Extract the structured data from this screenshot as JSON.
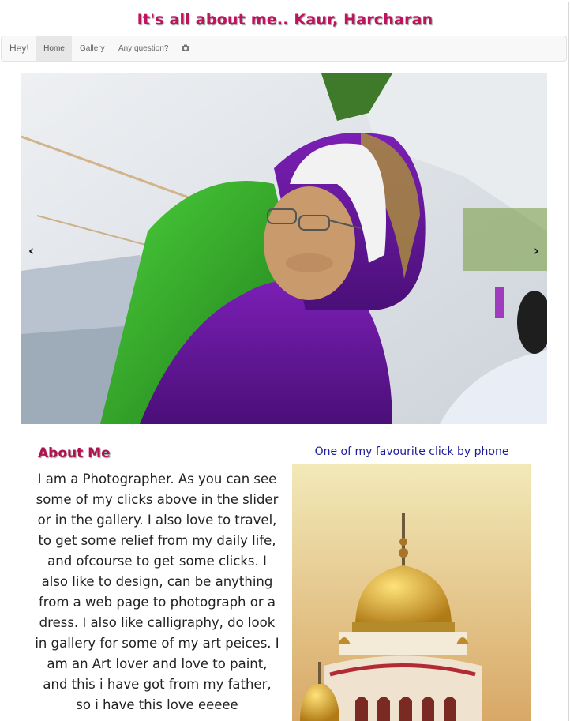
{
  "header": {
    "title": "It's all about me.. Kaur, Harcharan"
  },
  "nav": {
    "brand": "Hey!",
    "items": [
      {
        "label": "Home",
        "active": true
      },
      {
        "label": "Gallery",
        "active": false
      },
      {
        "label": "Any question?",
        "active": false
      }
    ],
    "camera_icon": "camera-icon"
  },
  "carousel": {
    "prev_glyph": "‹",
    "next_glyph": "›",
    "slide_description_icon": "photo"
  },
  "about": {
    "title": "About Me",
    "text": "I am a Photographer. As you can see some of my clicks above in the slider or in the gallery. I also love to travel, to get some relief from my daily life, and ofcourse to get some clicks. I also like to design, can be anything from a web page to photograph or a dress. I also like calligraphy, do look in gallery for some of my art peices. I am an Art lover and love to paint, and this i have got from my father, so i have this love eeeee"
  },
  "favourite": {
    "caption": "One of my favourite click by phone"
  },
  "colors": {
    "title": "#c0125f",
    "about_title": "#b0124f",
    "caption": "#1a1a9a",
    "navbar_bg": "#f8f8f8",
    "active_bg": "#e7e7e7"
  }
}
